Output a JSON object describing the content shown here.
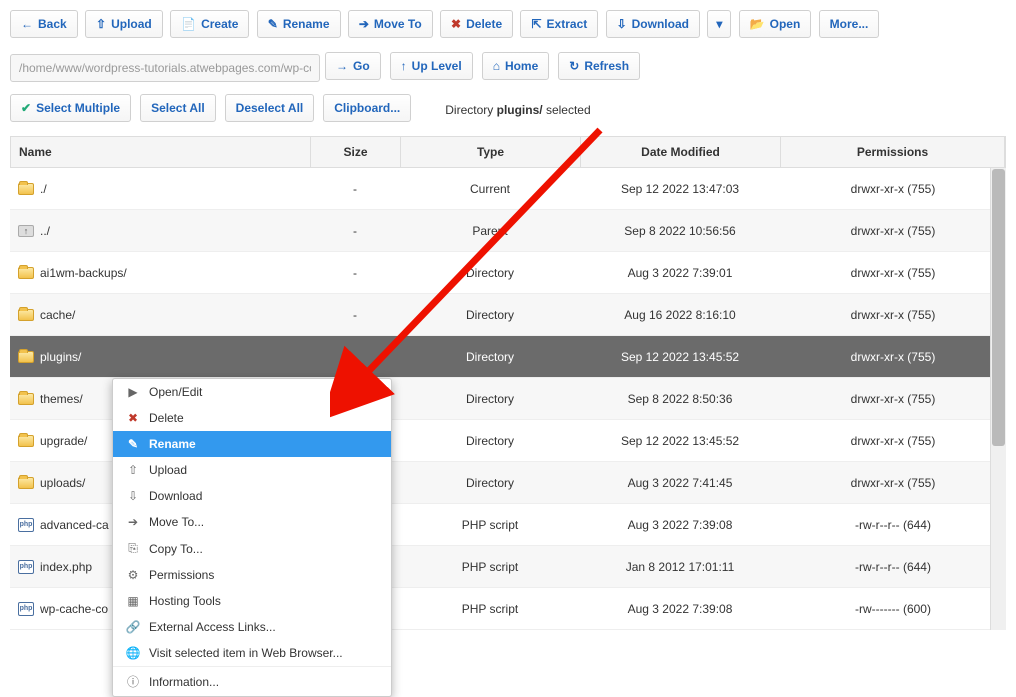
{
  "toolbar": {
    "back": "Back",
    "upload": "Upload",
    "create": "Create",
    "rename": "Rename",
    "moveto": "Move To",
    "delete": "Delete",
    "extract": "Extract",
    "download": "Download",
    "open": "Open",
    "more": "More..."
  },
  "pathbar": {
    "path": "/home/www/wordpress-tutorials.atwebpages.com/wp-con",
    "go": "Go",
    "uplevel": "Up Level",
    "home": "Home",
    "refresh": "Refresh"
  },
  "selbar": {
    "selectmultiple": "Select Multiple",
    "selectall": "Select All",
    "deselectall": "Deselect All",
    "clipboard": "Clipboard...",
    "status_prefix": "Directory ",
    "status_bold": "plugins/",
    "status_suffix": " selected"
  },
  "headers": {
    "name": "Name",
    "size": "Size",
    "type": "Type",
    "date": "Date Modified",
    "perm": "Permissions"
  },
  "rows": [
    {
      "icon": "folder",
      "name": "./",
      "size": "-",
      "type": "Current",
      "date": "Sep 12 2022 13:47:03",
      "perm": "drwxr-xr-x (755)",
      "sel": false
    },
    {
      "icon": "up",
      "name": "../",
      "size": "-",
      "type": "Parent",
      "date": "Sep 8 2022 10:56:56",
      "perm": "drwxr-xr-x (755)",
      "sel": false
    },
    {
      "icon": "folder",
      "name": "ai1wm-backups/",
      "size": "-",
      "type": "Directory",
      "date": "Aug 3 2022 7:39:01",
      "perm": "drwxr-xr-x (755)",
      "sel": false
    },
    {
      "icon": "folder",
      "name": "cache/",
      "size": "-",
      "type": "Directory",
      "date": "Aug 16 2022 8:16:10",
      "perm": "drwxr-xr-x (755)",
      "sel": false
    },
    {
      "icon": "folder",
      "name": "plugins/",
      "size": "-",
      "type": "Directory",
      "date": "Sep 12 2022 13:45:52",
      "perm": "drwxr-xr-x (755)",
      "sel": true
    },
    {
      "icon": "folder",
      "name": "themes/",
      "size": "",
      "type": "Directory",
      "date": "Sep 8 2022 8:50:36",
      "perm": "drwxr-xr-x (755)",
      "sel": false
    },
    {
      "icon": "folder",
      "name": "upgrade/",
      "size": "",
      "type": "Directory",
      "date": "Sep 12 2022 13:45:52",
      "perm": "drwxr-xr-x (755)",
      "sel": false
    },
    {
      "icon": "folder",
      "name": "uploads/",
      "size": "",
      "type": "Directory",
      "date": "Aug 3 2022 7:41:45",
      "perm": "drwxr-xr-x (755)",
      "sel": false
    },
    {
      "icon": "php",
      "name": "advanced-ca",
      "size": "",
      "type": "PHP script",
      "date": "Aug 3 2022 7:39:08",
      "perm": "-rw-r--r-- (644)",
      "sel": false
    },
    {
      "icon": "php",
      "name": "index.php",
      "size": "",
      "type": "PHP script",
      "date": "Jan 8 2012 17:01:11",
      "perm": "-rw-r--r-- (644)",
      "sel": false
    },
    {
      "icon": "php",
      "name": "wp-cache-co",
      "size": "",
      "type": "PHP script",
      "date": "Aug 3 2022 7:39:08",
      "perm": "-rw------- (600)",
      "sel": false
    }
  ],
  "ctx": [
    {
      "icon": "▶",
      "label": "Open/Edit",
      "hl": false,
      "name": "open-edit"
    },
    {
      "icon": "✖",
      "label": "Delete",
      "hl": false,
      "name": "delete",
      "iconcolor": "#c0392b"
    },
    {
      "icon": "✎",
      "label": "Rename",
      "hl": true,
      "name": "rename"
    },
    {
      "icon": "⇧",
      "label": "Upload",
      "hl": false,
      "name": "upload"
    },
    {
      "icon": "⇩",
      "label": "Download",
      "hl": false,
      "name": "download"
    },
    {
      "icon": "➔",
      "label": "Move To...",
      "hl": false,
      "name": "move-to"
    },
    {
      "icon": "⎘",
      "label": "Copy To...",
      "hl": false,
      "name": "copy-to"
    },
    {
      "icon": "⚙",
      "label": "Permissions",
      "hl": false,
      "name": "permissions"
    },
    {
      "icon": "▦",
      "label": "Hosting Tools",
      "hl": false,
      "name": "hosting-tools"
    },
    {
      "icon": "🔗",
      "label": "External Access Links...",
      "hl": false,
      "name": "external-links"
    },
    {
      "icon": "🌐",
      "label": "Visit selected item in Web Browser...",
      "hl": false,
      "name": "visit-browser"
    },
    {
      "sep": true
    },
    {
      "icon": "ⓘ",
      "label": "Information...",
      "hl": false,
      "name": "information"
    }
  ]
}
